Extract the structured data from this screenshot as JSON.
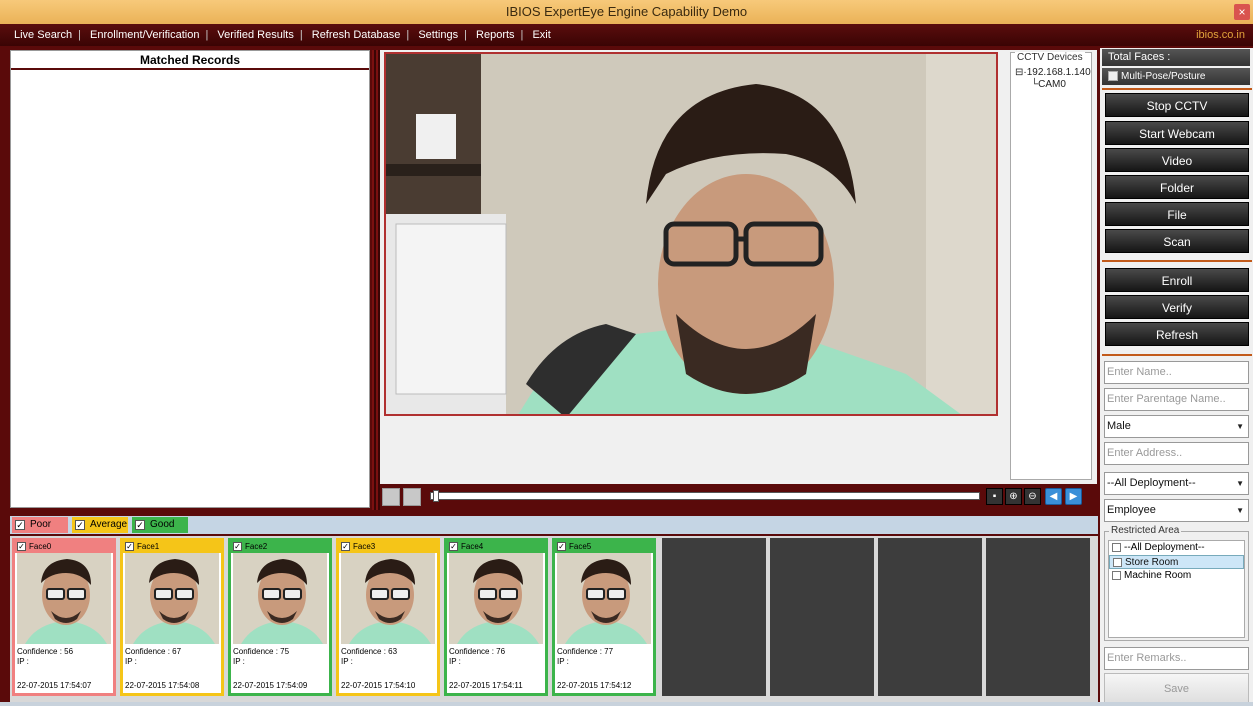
{
  "window": {
    "title": "IBIOS ExpertEye Engine Capability Demo",
    "close": "×"
  },
  "menu": {
    "items": [
      "Live Search",
      "Enrollment/Verification",
      "Verified Results",
      "Refresh Database",
      "Settings",
      "Reports",
      "Exit"
    ],
    "brand": "ibios.co.in"
  },
  "matched": {
    "header": "Matched Records"
  },
  "cctv": {
    "title": "CCTV Devices",
    "ip": "192.168.1.140",
    "cam": "CAM0"
  },
  "right": {
    "total_faces": "Total Faces :",
    "multi_pose": "Multi-Pose/Posture",
    "buttons1": [
      "Stop CCTV",
      "Start Webcam",
      "Video",
      "Folder",
      "File",
      "Scan"
    ],
    "buttons2": [
      "Enroll",
      "Verify",
      "Refresh"
    ],
    "name_ph": "Enter Name..",
    "parentage_ph": "Enter Parentage Name..",
    "gender": "Male",
    "address_ph": "Enter Address..",
    "deployment": "--All Deployment--",
    "category": "Employee",
    "restricted_title": "Restricted Area",
    "restricted_items": [
      "--All Deployment--",
      "Store Room",
      "Machine Room"
    ],
    "remarks_ph": "Enter Remarks..",
    "save": "Save"
  },
  "legend": {
    "poor": "Poor",
    "average": "Average",
    "good": "Good",
    "check": "✓",
    "colors": {
      "poor": "#f08080",
      "average": "#f5c518",
      "good": "#3cb44b"
    }
  },
  "faces": [
    {
      "name": "Face0",
      "confidence": "Confidence : 56",
      "ip": "IP :",
      "time": "22-07-2015 17:54:07",
      "quality": "poor"
    },
    {
      "name": "Face1",
      "confidence": "Confidence : 67",
      "ip": "IP :",
      "time": "22-07-2015 17:54:08",
      "quality": "average"
    },
    {
      "name": "Face2",
      "confidence": "Confidence : 75",
      "ip": "IP :",
      "time": "22-07-2015 17:54:09",
      "quality": "good"
    },
    {
      "name": "Face3",
      "confidence": "Confidence : 63",
      "ip": "IP :",
      "time": "22-07-2015 17:54:10",
      "quality": "average"
    },
    {
      "name": "Face4",
      "confidence": "Confidence : 76",
      "ip": "IP :",
      "time": "22-07-2015 17:54:11",
      "quality": "good"
    },
    {
      "name": "Face5",
      "confidence": "Confidence : 77",
      "ip": "IP :",
      "time": "22-07-2015 17:54:12",
      "quality": "good"
    }
  ]
}
